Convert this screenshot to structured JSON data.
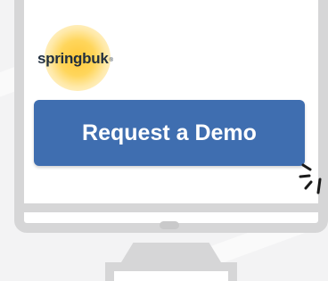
{
  "brand": {
    "name": "springbuk",
    "trademark": "®"
  },
  "cta": {
    "label": "Request a Demo"
  },
  "colors": {
    "button": "#3f6eb0",
    "monitor_frame": "#d6d6d7",
    "logo_glow": "#ffc93a",
    "logo_text": "#22303f",
    "burst": "#1a1a1a"
  },
  "icons": {
    "click_indicator": "click-burst-icon",
    "monitor": "monitor-icon"
  }
}
